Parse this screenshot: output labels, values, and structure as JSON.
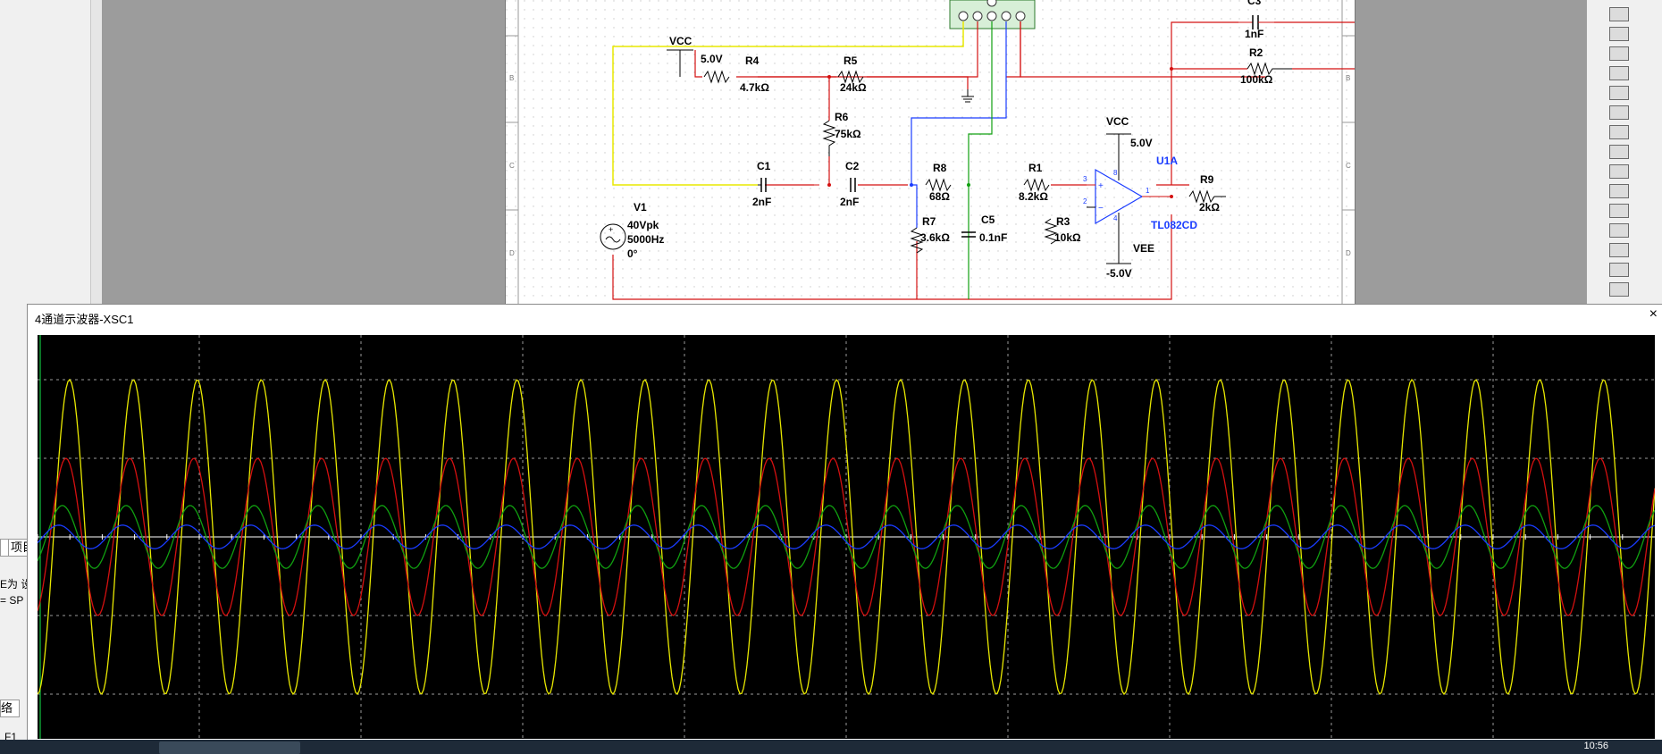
{
  "left_panel": {
    "tab_left_label": "",
    "tab_project_label": "项目",
    "text_line1": "E为 设",
    "text_line2": "= SP",
    "tab_bottom_label": "络",
    "help_key": "F1"
  },
  "schematic": {
    "components": {
      "vcc_top": "VCC",
      "vcc_top_value": "5.0V",
      "r4": "R4",
      "r4_value": "4.7kΩ",
      "r5": "R5",
      "r5_value": "24kΩ",
      "r6": "R6",
      "r6_value": "75kΩ",
      "c1": "C1",
      "c1_value": "2nF",
      "c2": "C2",
      "c2_value": "2nF",
      "r8": "R8",
      "r8_value": "68Ω",
      "r1": "R1",
      "r1_value": "8.2kΩ",
      "r7": "R7",
      "r7_value": "3.6kΩ",
      "c5": "C5",
      "c5_value": "0.1nF",
      "r3": "R3",
      "r3_value": "10kΩ",
      "v1": "V1",
      "v1_amp": "40Vpk",
      "v1_freq": "5000Hz",
      "v1_phase": "0°",
      "c3": "C3",
      "c3_value": "1nF",
      "r2": "R2",
      "r2_value": "100kΩ",
      "vcc_op": "VCC",
      "vcc_op_value": "5.0V",
      "u1a": "U1A",
      "u1a_part": "TL082CD",
      "vee": "VEE",
      "vee_value": "-5.0V",
      "r9": "R9",
      "r9_value": "2kΩ",
      "pin3": "3",
      "pin2": "2",
      "pin1": "1",
      "pin8": "8",
      "pin4": "4"
    },
    "border_labels": [
      "B",
      "C",
      "D"
    ]
  },
  "oscilloscope": {
    "title": "4通道示波器-XSC1",
    "close_label": "×",
    "cycles": 25.3,
    "channels": [
      {
        "name": "yellow",
        "color": "#e8e800",
        "amplitude_div": 2.0
      },
      {
        "name": "red",
        "color": "#d41010",
        "amplitude_div": 1.0
      },
      {
        "name": "green",
        "color": "#10a010",
        "amplitude_div": 0.4
      },
      {
        "name": "blue",
        "color": "#1a3cff",
        "amplitude_div": 0.15
      }
    ],
    "grid_colour": "#9a9a9a"
  },
  "taskbar": {
    "clock": "10:56"
  }
}
